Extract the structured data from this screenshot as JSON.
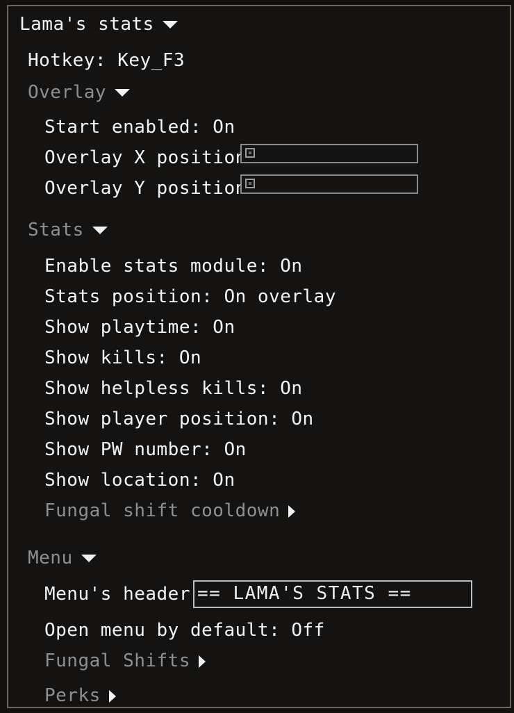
{
  "panel": {
    "title": "Lama's stats",
    "hotkey": "Hotkey: Key_F3"
  },
  "overlay": {
    "header": "Overlay",
    "start_enabled": "Start enabled: On",
    "x_label": "Overlay X position",
    "x_value": 0,
    "y_label": "Overlay Y position",
    "y_value": 0
  },
  "stats": {
    "header": "Stats",
    "items": [
      "Enable stats module: On",
      "Stats position: On overlay",
      "Show playtime: On",
      "Show kills: On",
      "Show helpless kills: On",
      "Show player position: On",
      "Show PW number: On",
      "Show location: On"
    ],
    "fungal_cooldown": "Fungal shift cooldown"
  },
  "menu": {
    "header": "Menu",
    "header_label": "Menu's header",
    "header_value": "== LAMA'S STATS ==",
    "open_default": "Open menu by default: Off",
    "fungal_shifts": "Fungal Shifts",
    "perks": "Perks"
  },
  "icons": {
    "expanded": "triangle-down-icon",
    "collapsed": "triangle-right-icon"
  }
}
